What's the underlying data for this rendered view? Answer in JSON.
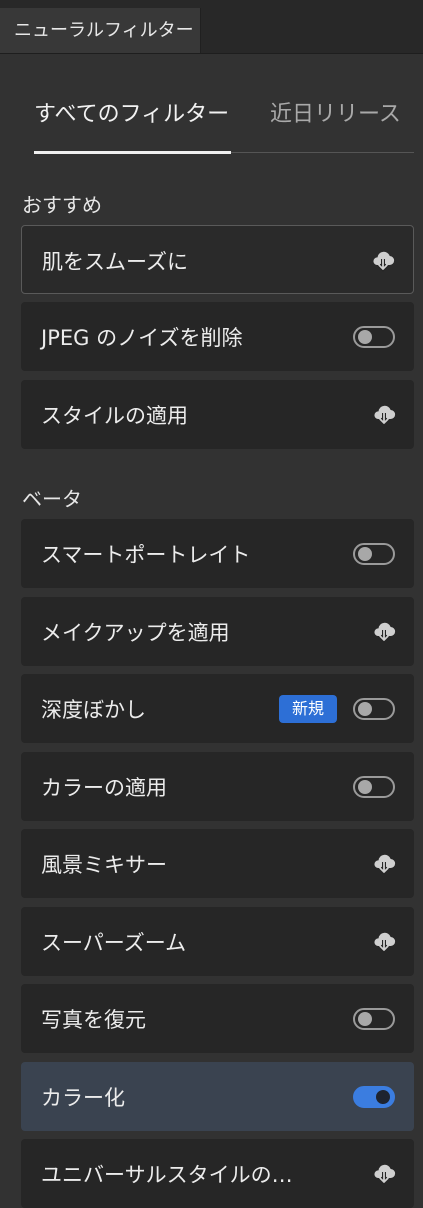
{
  "panel": {
    "title": "ニューラルフィルター"
  },
  "tabs": {
    "all": "すべてのフィルター",
    "recent": "近日リリース"
  },
  "sections": {
    "featured": "おすすめ",
    "beta": "ベータ"
  },
  "featured": [
    {
      "label": "肌をスムーズに",
      "control": "cloud-download"
    },
    {
      "label": "JPEG のノイズを削除",
      "control": "toggle",
      "state": "off"
    },
    {
      "label": "スタイルの適用",
      "control": "cloud-download"
    }
  ],
  "beta": [
    {
      "label": "スマートポートレイト",
      "control": "toggle",
      "state": "off"
    },
    {
      "label": "メイクアップを適用",
      "control": "cloud-download"
    },
    {
      "label": "深度ぼかし",
      "control": "toggle",
      "state": "off",
      "badge": "新規"
    },
    {
      "label": "カラーの適用",
      "control": "toggle",
      "state": "off"
    },
    {
      "label": "風景ミキサー",
      "control": "cloud-download"
    },
    {
      "label": "スーパーズーム",
      "control": "cloud-download"
    },
    {
      "label": "写真を復元",
      "control": "toggle",
      "state": "off"
    },
    {
      "label": "カラー化",
      "control": "toggle",
      "state": "on"
    },
    {
      "label": "ユニバーサルスタイルの…",
      "control": "cloud-download"
    }
  ],
  "colors": {
    "background": "#323232",
    "card": "#262626",
    "accent": "#3b7de0",
    "active_card": "#3a4350"
  }
}
